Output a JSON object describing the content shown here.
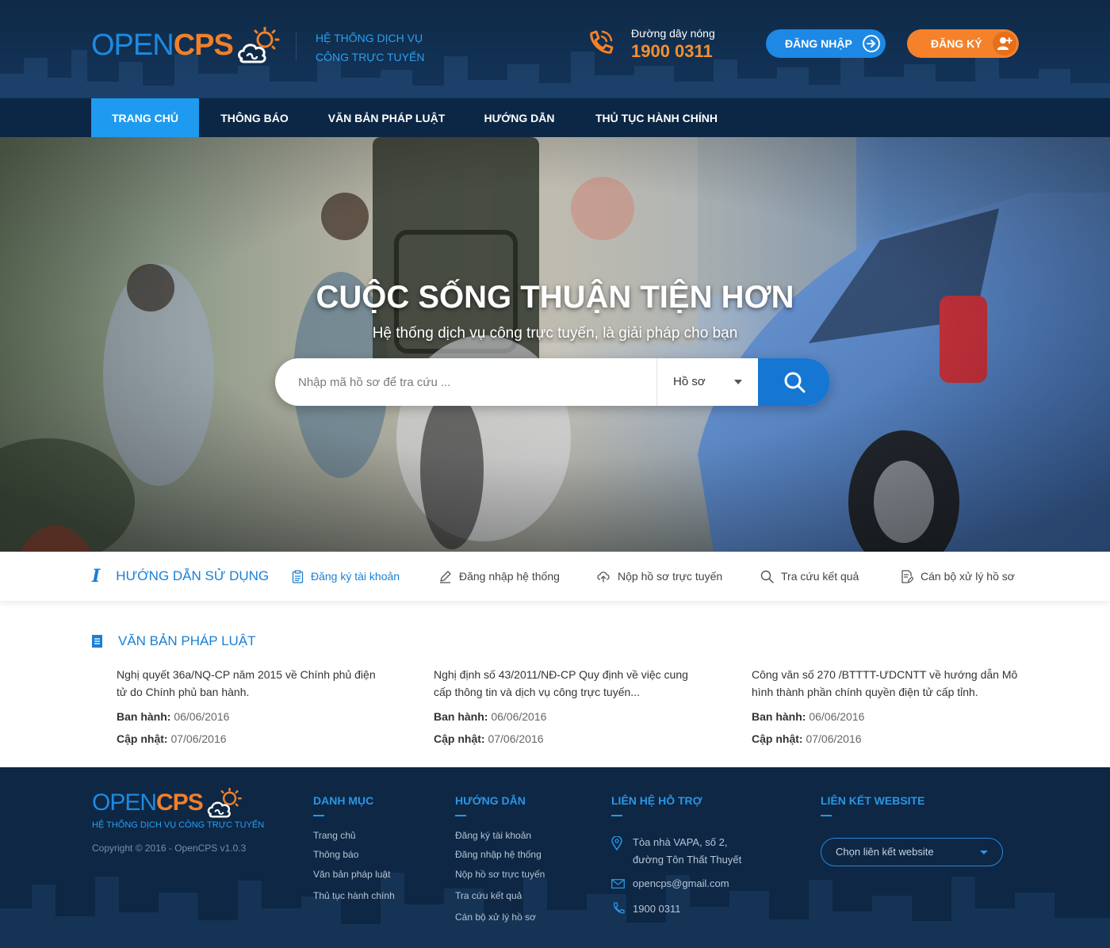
{
  "header": {
    "logo_open": "OPEN",
    "logo_cps": "CPS",
    "tagline_line1": "HỆ THỐNG DỊCH VỤ",
    "tagline_line2": "CÔNG TRỰC TUYẾN",
    "hotline_label": "Đường dây nóng",
    "hotline_number": "1900 0311",
    "login_label": "ĐĂNG NHẬP",
    "register_label": "ĐĂNG KÝ"
  },
  "nav": {
    "items": [
      {
        "label": "TRANG CHỦ",
        "active": true
      },
      {
        "label": "THÔNG BÁO",
        "active": false
      },
      {
        "label": "VĂN BẢN PHÁP LUẬT",
        "active": false
      },
      {
        "label": "HƯỚNG DẪN",
        "active": false
      },
      {
        "label": "THỦ TỤC HÀNH CHÍNH",
        "active": false
      }
    ]
  },
  "hero": {
    "title": "CUỘC SỐNG THUẬN TIỆN HƠN",
    "subtitle": "Hệ thống dịch vụ công trực tuyến, là giải pháp cho bạn",
    "search_placeholder": "Nhập mã hồ sơ để tra cứu ...",
    "search_type": "Hồ sơ"
  },
  "guide": {
    "title": "HƯỚNG DẪN SỬ DỤNG",
    "links": [
      {
        "label": "Đăng ký tài khoản",
        "icon": "clipboard-icon"
      },
      {
        "label": "Đăng nhập hệ thống",
        "icon": "pencil-icon"
      },
      {
        "label": "Nộp hồ sơ trực tuyến",
        "icon": "cloud-upload-icon"
      },
      {
        "label": "Tra cứu kết quả",
        "icon": "search-icon"
      },
      {
        "label": "Cán bộ xử lý hồ sơ",
        "icon": "document-edit-icon"
      }
    ]
  },
  "docs": {
    "title": "VĂN BẢN PHÁP LUẬT",
    "issued_label": "Ban hành:",
    "updated_label": "Cập nhật:",
    "items": [
      {
        "title": "Nghị quyết 36a/NQ-CP năm 2015 về Chính phủ điện tử do Chính phủ ban hành.",
        "issued": "06/06/2016",
        "updated": "07/06/2016"
      },
      {
        "title": "Nghị định số 43/2011/NĐ-CP Quy định về việc cung cấp thông tin và dịch vụ công trực tuyến...",
        "issued": "06/06/2016",
        "updated": "07/06/2016"
      },
      {
        "title": "Công văn số 270 /BTTTT-ƯDCNTT về hướng dẫn Mô hình thành phần chính quyền điện tử cấp tỉnh.",
        "issued": "06/06/2016",
        "updated": "07/06/2016"
      }
    ]
  },
  "footer": {
    "tagline": "HỆ THỐNG DỊCH VỤ CÔNG TRỰC TUYẾN",
    "copyright": "Copyright © 2016 - OpenCPS v1.0.3",
    "col_categories_title": "DANH MỤC",
    "categories": [
      "Trang chủ",
      "Thông báo",
      "Văn bản pháp luật",
      "Thủ tục hành chính"
    ],
    "col_guide_title": "HƯỚNG DẪN",
    "guides": [
      "Đăng ký tài khoản",
      "Đăng nhập hệ thống",
      "Nộp hồ sơ trực tuyến",
      "Tra cứu kết quả",
      "Cán bộ xử lý hồ sơ"
    ],
    "col_contact_title": "LIÊN HỆ HỖ TRỢ",
    "address_line1": "Tòa nhà VAPA, số 2,",
    "address_line2": "đường Tôn Thất Thuyết",
    "email": "opencps@gmail.com",
    "phone": "1900 0311",
    "col_links_title": "LIÊN KẾT WEBSITE",
    "links_select": "Chọn liên kết website"
  },
  "colors": {
    "brand_blue": "#1e88e5",
    "brand_orange": "#f5822a",
    "navy": "#0d2745",
    "nav_active": "#1e9bf0"
  }
}
